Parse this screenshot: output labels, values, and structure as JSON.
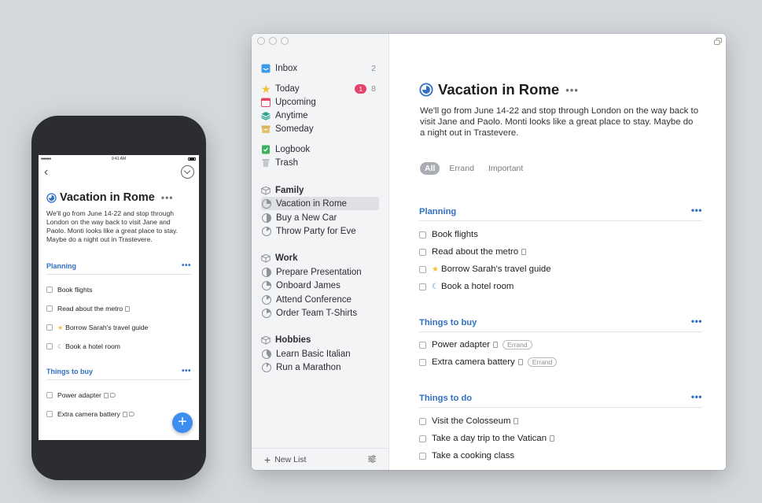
{
  "phone": {
    "status": {
      "carrier": "●●●●● ",
      "time": "9:41 AM"
    },
    "project": {
      "title": "Vacation in Rome",
      "notes": "We'll go from June 14-22 and stop through London on the way back to visit Jane and Paolo. Monti looks like a great place to stay. Maybe do a night out in Trastevere."
    },
    "headings": [
      {
        "label": "Planning",
        "todos": [
          "Book flights",
          "Read about the metro",
          "Borrow Sarah's travel guide",
          "Book a hotel room"
        ]
      },
      {
        "label": "Things to buy",
        "todos": [
          "Power adapter",
          "Extra camera battery"
        ]
      }
    ],
    "fab": "+"
  },
  "sidebar": {
    "inbox": {
      "label": "Inbox",
      "count": "2"
    },
    "today": {
      "label": "Today",
      "badge": "1",
      "count": "8"
    },
    "upcoming": {
      "label": "Upcoming"
    },
    "anytime": {
      "label": "Anytime"
    },
    "someday": {
      "label": "Someday"
    },
    "logbook": {
      "label": "Logbook"
    },
    "trash": {
      "label": "Trash"
    },
    "areas": [
      {
        "label": "Family",
        "projects": [
          "Vacation in Rome",
          "Buy a New Car",
          "Throw Party for Eve"
        ]
      },
      {
        "label": "Work",
        "projects": [
          "Prepare Presentation",
          "Onboard James",
          "Attend Conference",
          "Order Team T-Shirts"
        ]
      },
      {
        "label": "Hobbies",
        "projects": [
          "Learn Basic Italian",
          "Run a Marathon"
        ]
      }
    ],
    "new_list": "New List"
  },
  "main": {
    "title": "Vacation in Rome",
    "notes": "We'll go from June 14-22 and stop through London on the way back to visit Jane and Paolo. Monti looks like a great place to stay. Maybe do a night out in Trastevere.",
    "tags": [
      "All",
      "Errand",
      "Important"
    ],
    "headings": [
      {
        "label": "Planning",
        "todos": [
          "Book flights",
          "Read about the metro",
          "Borrow Sarah's travel guide",
          "Book a hotel room"
        ]
      },
      {
        "label": "Things to buy",
        "todos": [
          "Power adapter",
          "Extra camera battery"
        ],
        "pill": "Errand"
      },
      {
        "label": "Things to do",
        "todos": [
          "Visit the Colosseum",
          "Take a day trip to the Vatican",
          "Take a cooking class"
        ]
      }
    ]
  },
  "colors": {
    "accent": "#2f6fc4",
    "today_badge": "#e8416d",
    "star": "#f2c12e",
    "fab": "#3d8ef0"
  }
}
